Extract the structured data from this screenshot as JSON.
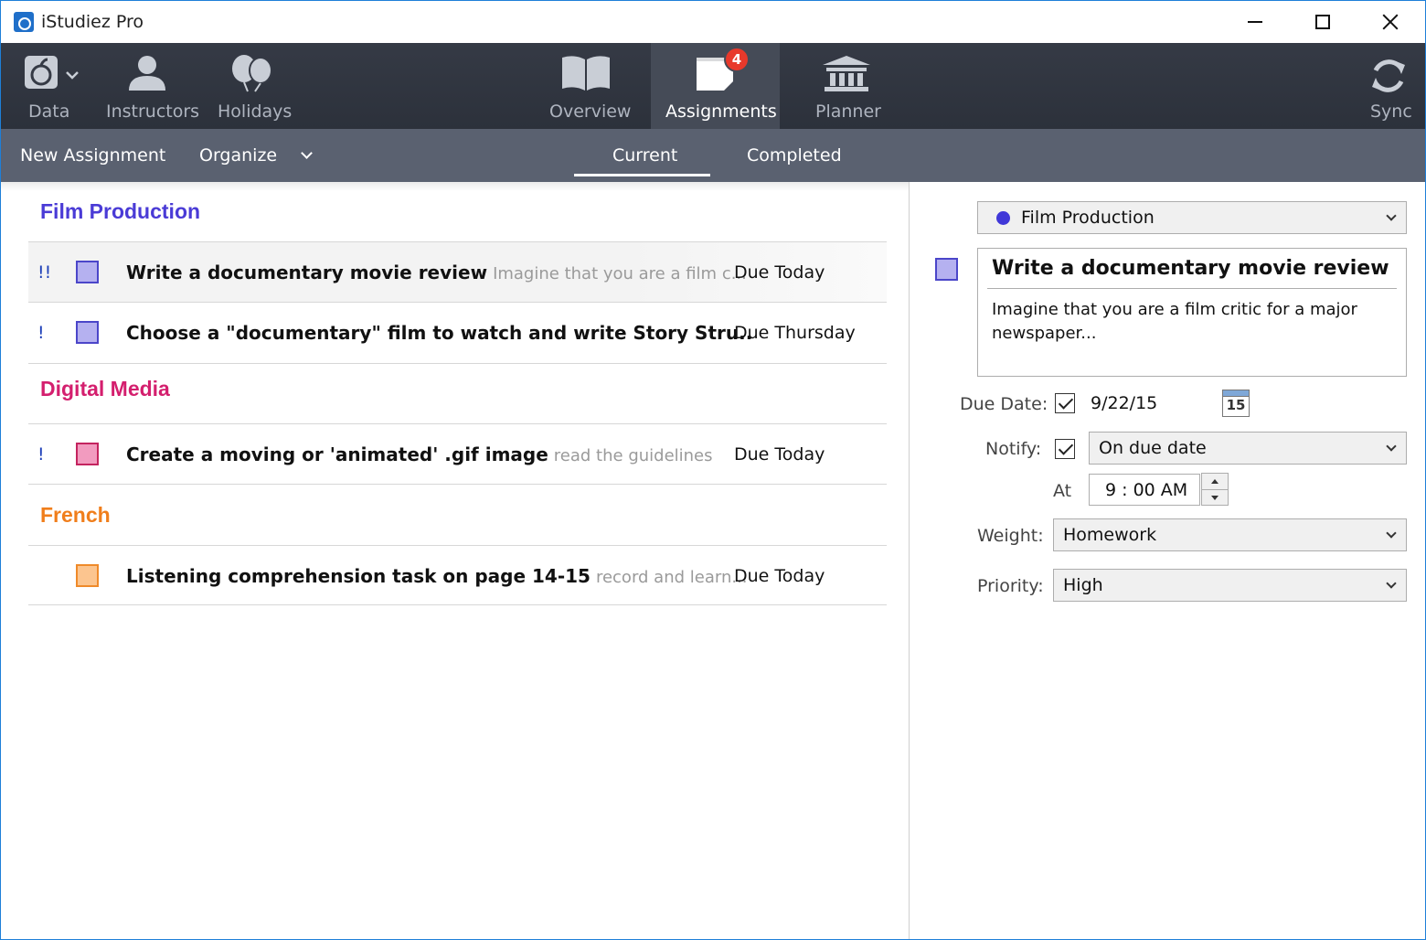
{
  "window": {
    "title": "iStudiez Pro",
    "minimize_icon": "minimize-icon",
    "maximize_icon": "maximize-icon",
    "close_icon": "close-icon"
  },
  "toolbar": {
    "left": [
      {
        "label": "Data",
        "icon": "apple-database-icon"
      },
      {
        "label": "Instructors",
        "icon": "person-icon"
      },
      {
        "label": "Holidays",
        "icon": "balloons-icon"
      }
    ],
    "center": [
      {
        "label": "Overview",
        "icon": "book-icon"
      },
      {
        "label": "Assignments",
        "icon": "notes-icon",
        "badge": "4",
        "active": true
      },
      {
        "label": "Planner",
        "icon": "building-icon"
      }
    ],
    "sync": {
      "label": "Sync",
      "icon": "sync-icon"
    }
  },
  "subbar": {
    "new_assignment": "New Assignment",
    "organize": "Organize",
    "tabs": [
      "Current",
      "Completed"
    ],
    "active_tab": "Current"
  },
  "groups": [
    {
      "name": "Film Production",
      "color": "#4a3bd6",
      "swatch_fill": "#b5b1f0",
      "swatch_border": "#4b46c9",
      "items": [
        {
          "priority": "!!",
          "title": "Write a documentary movie review",
          "note": "Imagine that you are a film c...",
          "due": "Due Today",
          "selected": true
        },
        {
          "priority": "!",
          "title": "Choose a \"documentary\" film to watch and write Story Stru..",
          "note": "",
          "due": "Due Thursday"
        }
      ]
    },
    {
      "name": "Digital Media",
      "color": "#d41f6e",
      "swatch_fill": "#f29bbf",
      "swatch_border": "#c4245f",
      "items": [
        {
          "priority": "!",
          "title": "Create a moving or 'animated' .gif image",
          "note": "read the guidelines",
          "due": "Due Today"
        }
      ]
    },
    {
      "name": "French",
      "color": "#f07e1b",
      "swatch_fill": "#fcc58f",
      "swatch_border": "#ef8a2a",
      "items": [
        {
          "priority": "",
          "title": "Listening comprehension task on page 14-15",
          "note": "record and learn...",
          "due": "Due Today"
        }
      ]
    }
  ],
  "detail": {
    "course": "Film Production",
    "course_color": "#4038d8",
    "title": "Write a documentary movie review",
    "description": "Imagine that you are a film critic for a major newspaper...",
    "due_date_label": "Due Date:",
    "due_date": "9/22/15",
    "calendar_day": "15",
    "notify_label": "Notify:",
    "notify": "On due date",
    "at_label": "At",
    "time": "9 : 00  AM",
    "weight_label": "Weight:",
    "weight": "Homework",
    "priority_label": "Priority:",
    "priority": "High"
  }
}
